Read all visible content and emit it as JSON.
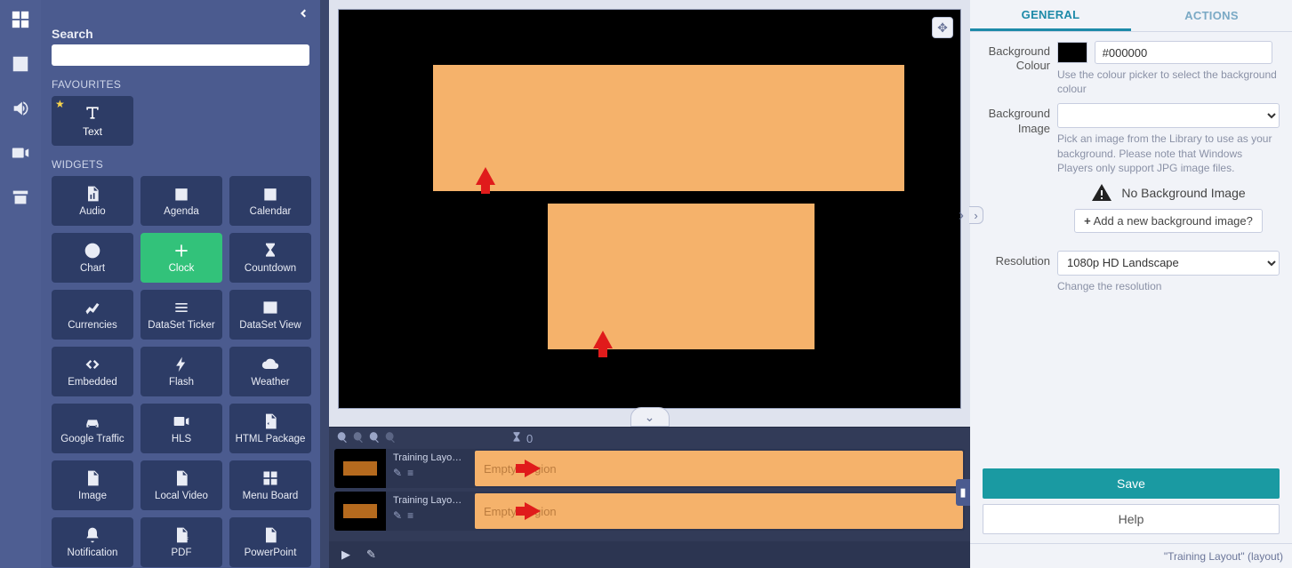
{
  "rail": {
    "items": [
      "grid",
      "image",
      "audio",
      "video",
      "archive"
    ]
  },
  "search": {
    "label": "Search",
    "value": ""
  },
  "favourites": {
    "heading": "FAVOURITES",
    "items": [
      {
        "label": "Text",
        "icon": "text"
      }
    ]
  },
  "widgets": {
    "heading": "WIDGETS",
    "items": [
      {
        "label": "Audio",
        "icon": "file-audio"
      },
      {
        "label": "Agenda",
        "icon": "calendar"
      },
      {
        "label": "Calendar",
        "icon": "calendar"
      },
      {
        "label": "Chart",
        "icon": "pie"
      },
      {
        "label": "Clock",
        "icon": "plus",
        "highlight": true
      },
      {
        "label": "Countdown",
        "icon": "hourglass"
      },
      {
        "label": "Currencies",
        "icon": "line"
      },
      {
        "label": "DataSet Ticker",
        "icon": "list"
      },
      {
        "label": "DataSet View",
        "icon": "table"
      },
      {
        "label": "Embedded",
        "icon": "code"
      },
      {
        "label": "Flash",
        "icon": "bolt"
      },
      {
        "label": "Weather",
        "icon": "cloud"
      },
      {
        "label": "Google Traffic",
        "icon": "car"
      },
      {
        "label": "HLS",
        "icon": "cam"
      },
      {
        "label": "HTML Package",
        "icon": "file-code"
      },
      {
        "label": "Image",
        "icon": "file-image"
      },
      {
        "label": "Local Video",
        "icon": "file-video"
      },
      {
        "label": "Menu Board",
        "icon": "grid"
      },
      {
        "label": "Notification",
        "icon": "bell"
      },
      {
        "label": "PDF",
        "icon": "file-pdf"
      },
      {
        "label": "PowerPoint",
        "icon": "file-ppt"
      }
    ]
  },
  "canvas": {
    "regions": [
      {
        "name": "region-1"
      },
      {
        "name": "region-2"
      }
    ]
  },
  "timeline": {
    "duration_label": "0",
    "rows": [
      {
        "title": "Training Layo…",
        "region_text": "Empty Region"
      },
      {
        "title": "Training Layo…",
        "region_text": "Empty Region"
      }
    ]
  },
  "props": {
    "tabs": {
      "general": "GENERAL",
      "actions": "ACTIONS"
    },
    "bg_colour": {
      "label": "Background Colour",
      "value": "#000000",
      "help": "Use the colour picker to select the background colour"
    },
    "bg_image": {
      "label": "Background Image",
      "selected": "",
      "help": "Pick an image from the Library to use as your background. Please note that Windows Players only support JPG image files.",
      "none_text": "No Background Image",
      "add_text": "Add a new background image?"
    },
    "resolution": {
      "label": "Resolution",
      "selected": "1080p HD Landscape",
      "help": "Change the resolution"
    },
    "save_label": "Save",
    "help_label": "Help",
    "footer": "\"Training Layout\" (layout)"
  }
}
